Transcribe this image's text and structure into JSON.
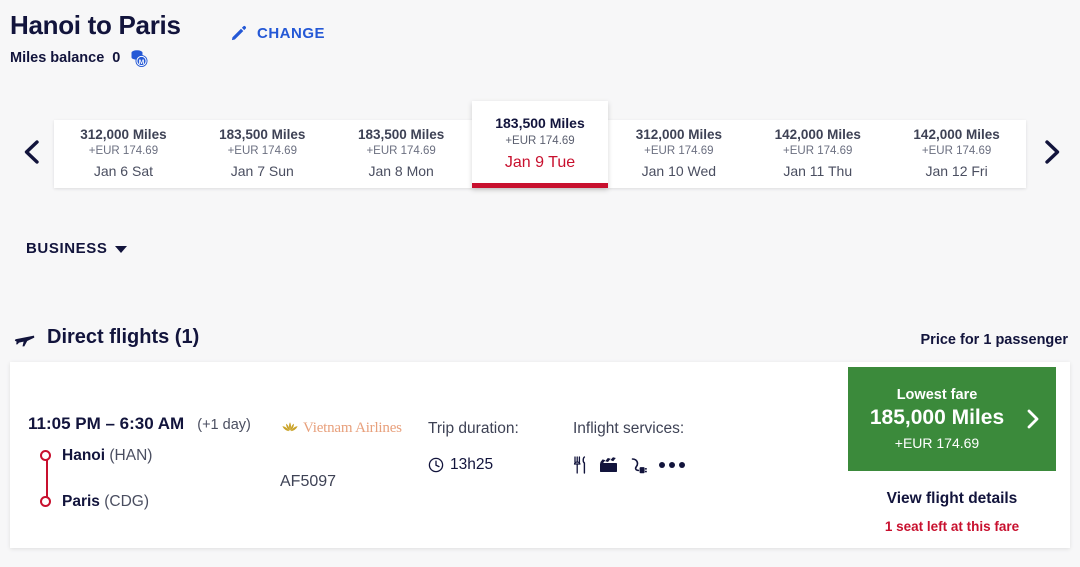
{
  "header": {
    "route_title": "Hanoi to Paris",
    "change_label": "CHANGE",
    "pencil_icon": "pencil-icon",
    "miles_balance_label": "Miles balance",
    "miles_balance_value": "0",
    "coins_icon": "coins-icon"
  },
  "colors": {
    "accent_red": "#C8102E",
    "link_blue": "#2458D6",
    "navy": "#12143C",
    "fare_green": "#3B8A3B",
    "page_bg": "#F7F7F8",
    "airline_gold": "#C9A227",
    "airline_text": "#E8A07C"
  },
  "carousel": {
    "prev_icon": "chevron-left-icon",
    "next_icon": "chevron-right-icon",
    "dates": [
      {
        "miles": "312,000 Miles",
        "cash": "+EUR 174.69",
        "date": "Jan 6 Sat",
        "selected": false
      },
      {
        "miles": "183,500 Miles",
        "cash": "+EUR 174.69",
        "date": "Jan 7 Sun",
        "selected": false
      },
      {
        "miles": "183,500 Miles",
        "cash": "+EUR 174.69",
        "date": "Jan 8 Mon",
        "selected": false
      },
      {
        "miles": "183,500 Miles",
        "cash": "+EUR 174.69",
        "date": "Jan 9 Tue",
        "selected": true
      },
      {
        "miles": "312,000 Miles",
        "cash": "+EUR 174.69",
        "date": "Jan 10 Wed",
        "selected": false
      },
      {
        "miles": "142,000 Miles",
        "cash": "+EUR 174.69",
        "date": "Jan 11 Thu",
        "selected": false
      },
      {
        "miles": "142,000 Miles",
        "cash": "+EUR 174.69",
        "date": "Jan 12 Fri",
        "selected": false
      }
    ],
    "selected": {
      "miles": "183,500 Miles",
      "cash": "+EUR 174.69",
      "date": "Jan 9 Tue"
    }
  },
  "cabin": {
    "label": "BUSINESS",
    "caret_icon": "chevron-down-icon"
  },
  "section": {
    "plane_icon": "plane-icon",
    "title": "Direct flights (1)",
    "price_note": "Price for 1 passenger"
  },
  "flight": {
    "times": "11:05 PM – 6:30 AM",
    "day_offset": "(+1 day)",
    "origin_city": "Hanoi",
    "origin_code": "(HAN)",
    "dest_city": "Paris",
    "dest_code": "(CDG)",
    "airline_name": "Vietnam Airlines",
    "airline_logo_icon": "lotus-icon",
    "flight_number": "AF5097",
    "duration_title": "Trip duration:",
    "duration_icon": "clock-icon",
    "duration_value": "13h25",
    "services_title": "Inflight services:",
    "service_icons": [
      "cutlery-icon",
      "movie-icon",
      "power-plug-icon",
      "more-dots-icon"
    ],
    "fare": {
      "label": "Lowest fare",
      "amount": "185,000 Miles",
      "cash": "+EUR 174.69",
      "chevron_icon": "chevron-right-icon"
    },
    "view_details": "View flight details",
    "seats_left": "1 seat left at this fare"
  }
}
